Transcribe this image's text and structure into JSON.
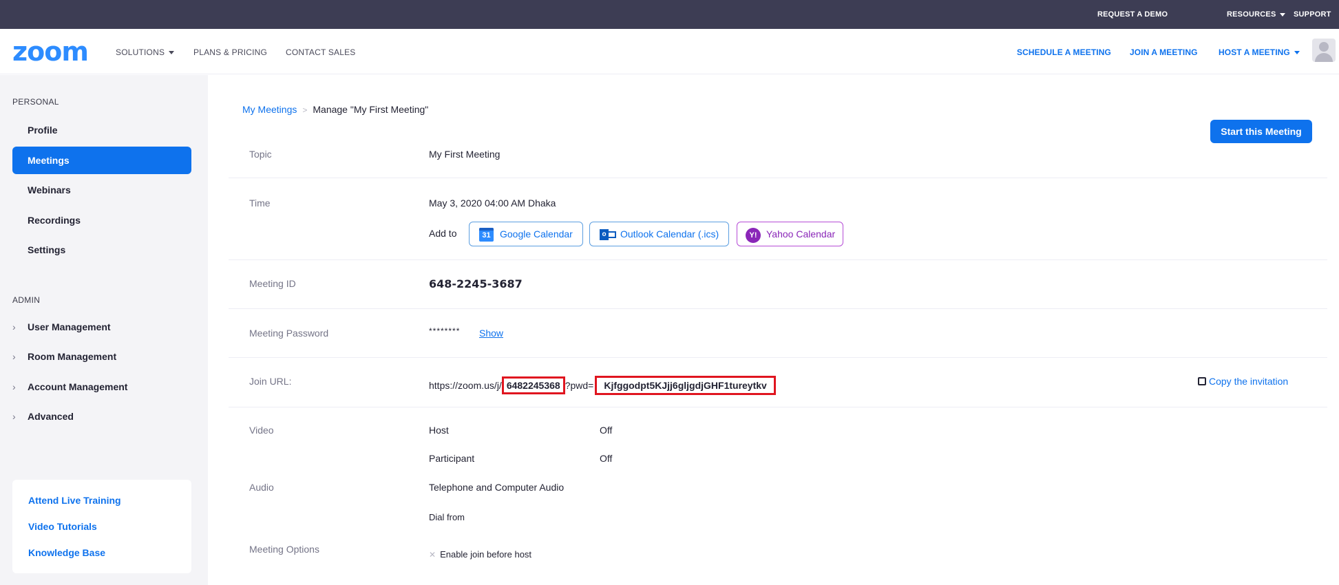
{
  "topbar": {
    "request_demo": "REQUEST A DEMO",
    "resources": "RESOURCES",
    "support": "SUPPORT"
  },
  "nav": {
    "logo": "zoom",
    "solutions": "SOLUTIONS",
    "plans_pricing": "PLANS & PRICING",
    "contact_sales": "CONTACT SALES",
    "schedule": "SCHEDULE A MEETING",
    "join": "JOIN A MEETING",
    "host": "HOST A MEETING"
  },
  "sidebar": {
    "personal_heading": "PERSONAL",
    "personal_items": [
      "Profile",
      "Meetings",
      "Webinars",
      "Recordings",
      "Settings"
    ],
    "active_item": "Meetings",
    "admin_heading": "ADMIN",
    "admin_items": [
      "User Management",
      "Room Management",
      "Account Management",
      "Advanced"
    ],
    "help_links": [
      "Attend Live Training",
      "Video Tutorials",
      "Knowledge Base"
    ]
  },
  "breadcrumb": {
    "parent": "My Meetings",
    "separator": ">",
    "current": "Manage \"My First Meeting\""
  },
  "start_button": "Start this Meeting",
  "meeting": {
    "topic_label": "Topic",
    "topic": "My First Meeting",
    "time_label": "Time",
    "time": "May 3, 2020 04:00 AM  Dhaka",
    "add_to": "Add to",
    "calendars": {
      "google": "Google Calendar",
      "google_icon_text": "31",
      "outlook": "Outlook Calendar (.ics)",
      "outlook_icon_text": "o",
      "yahoo": "Yahoo Calendar",
      "yahoo_icon_text": "Y!"
    },
    "id_label": "Meeting ID",
    "id": "648-2245-3687",
    "password_label": "Meeting Password",
    "password_masked": "********",
    "show": "Show",
    "join_url_label": "Join URL:",
    "join_url_prefix": "https://zoom.us/j/",
    "join_url_id": "6482245368",
    "join_url_pwd_prefix": "?pwd=",
    "join_url_pwd": "Kjfggodpt5KJjj6gljgdjGHF1tureytkv",
    "copy_invitation": "Copy the invitation",
    "video_label": "Video",
    "host_label": "Host",
    "host_value": "Off",
    "participant_label": "Participant",
    "participant_value": "Off",
    "audio_label": "Audio",
    "audio_value": "Telephone and Computer Audio",
    "dial_from": "Dial from",
    "options_label": "Meeting Options",
    "option_join_before_host": "Enable join before host"
  },
  "colors": {
    "topbar_bg": "#3d3d54",
    "brand_blue": "#0e72ed",
    "logo_blue": "#2d8cff",
    "highlight_red": "#e0151f",
    "yahoo_purple": "#8a26b8"
  },
  "icons": {
    "google_calendar": "google-calendar-icon",
    "outlook": "outlook-icon",
    "yahoo": "yahoo-icon",
    "copy": "copy-icon",
    "avatar": "avatar-icon"
  }
}
